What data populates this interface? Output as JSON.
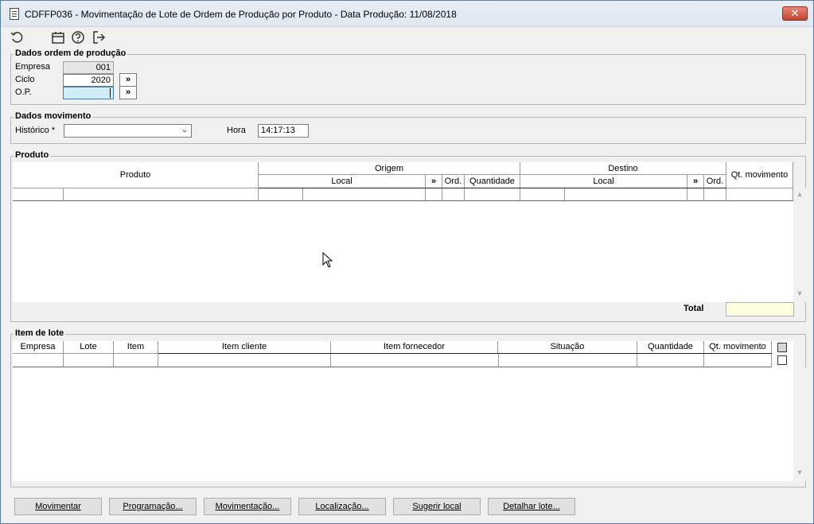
{
  "window": {
    "title": "CDFFP036 - Movimentação de Lote de Ordem de Produção por Produto - Data Produção: 11/08/2018",
    "close_label": "✕"
  },
  "toolbar": {
    "icons": [
      "undo-icon",
      "calendar-icon",
      "help-icon",
      "exit-icon"
    ]
  },
  "dados_ordem": {
    "legend": "Dados ordem de produção",
    "empresa_label": "Empresa",
    "empresa_value": "001",
    "ciclo_label": "Ciclo",
    "ciclo_value": "2020",
    "op_label": "O.P.",
    "op_value": "",
    "lookup_label": "»"
  },
  "dados_movimento": {
    "legend": "Dados movimento",
    "historico_label": "Histórico *",
    "historico_value": "",
    "hora_label": "Hora",
    "hora_value": "14:17:13"
  },
  "produto": {
    "legend": "Produto",
    "headers": {
      "produto": "Produto",
      "origem": "Origem",
      "destino": "Destino",
      "qt_movimento": "Qt. movimento",
      "local": "Local",
      "lookup": "»",
      "ord": "Ord.",
      "quantidade": "Quantidade"
    },
    "total_label": "Total",
    "total_value": ""
  },
  "item_lote": {
    "legend": "Item de lote",
    "columns": [
      "Empresa",
      "Lote",
      "Item",
      "Item cliente",
      "Item fornecedor",
      "Situação",
      "Quantidade",
      "Qt. movimento"
    ]
  },
  "buttons": [
    "Movimentar",
    "Programação...",
    "Movimentação...",
    "Localização...",
    "Sugerir local",
    "Detalhar lote..."
  ]
}
